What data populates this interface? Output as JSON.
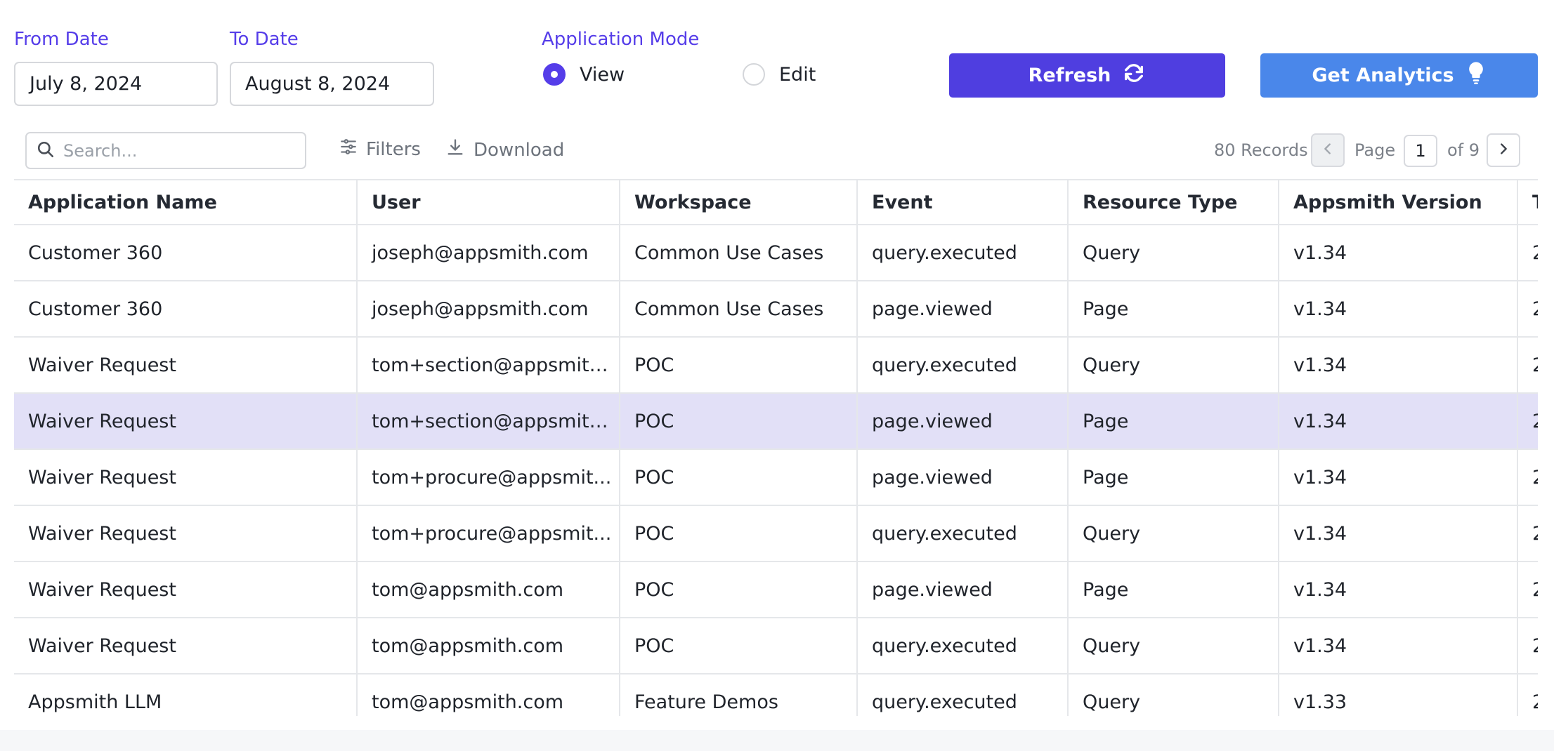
{
  "filters": {
    "from_date_label": "From Date",
    "from_date_value": "July 8, 2024",
    "to_date_label": "To Date",
    "to_date_value": "August 8, 2024",
    "mode_label": "Application Mode",
    "modes": [
      {
        "label": "View",
        "selected": true
      },
      {
        "label": "Edit",
        "selected": false
      }
    ]
  },
  "actions": {
    "refresh_label": "Refresh",
    "analytics_label": "Get Analytics"
  },
  "toolbar": {
    "search_placeholder": "Search...",
    "filters_label": "Filters",
    "download_label": "Download",
    "records_text": "80 Records",
    "page_label": "Page",
    "page_number": "1",
    "of_pages": "of 9"
  },
  "table": {
    "headers": [
      "Application Name",
      "User",
      "Workspace",
      "Event",
      "Resource Type",
      "Appsmith Version",
      "T"
    ],
    "rows": [
      [
        "Customer 360",
        "joseph@appsmith.com",
        "Common Use Cases",
        "query.executed",
        "Query",
        "v1.34",
        "2"
      ],
      [
        "Customer 360",
        "joseph@appsmith.com",
        "Common Use Cases",
        "page.viewed",
        "Page",
        "v1.34",
        "2"
      ],
      [
        "Waiver Request",
        "tom+section@appsmith...",
        "POC",
        "query.executed",
        "Query",
        "v1.34",
        "2"
      ],
      [
        "Waiver Request",
        "tom+section@appsmith...",
        "POC",
        "page.viewed",
        "Page",
        "v1.34",
        "2"
      ],
      [
        "Waiver Request",
        "tom+procure@appsmit...",
        "POC",
        "page.viewed",
        "Page",
        "v1.34",
        "2"
      ],
      [
        "Waiver Request",
        "tom+procure@appsmit...",
        "POC",
        "query.executed",
        "Query",
        "v1.34",
        "2"
      ],
      [
        "Waiver Request",
        "tom@appsmith.com",
        "POC",
        "page.viewed",
        "Page",
        "v1.34",
        "2"
      ],
      [
        "Waiver Request",
        "tom@appsmith.com",
        "POC",
        "query.executed",
        "Query",
        "v1.34",
        "2"
      ],
      [
        "Appsmith LLM",
        "tom@appsmith.com",
        "Feature Demos",
        "query.executed",
        "Query",
        "v1.33",
        "2"
      ]
    ],
    "selected_row": 3
  },
  "colors": {
    "accent": "#553de9",
    "refresh_button": "#4f3ee0",
    "analytics_button": "#4a87ea",
    "selected_row": "#e2e0f7"
  },
  "icons": {
    "refresh": "refresh-icon",
    "analytics": "lightbulb-icon",
    "search": "search-icon",
    "filters": "filters-icon",
    "download": "download-icon",
    "prev": "chevron-left-icon",
    "next": "chevron-right-icon"
  }
}
